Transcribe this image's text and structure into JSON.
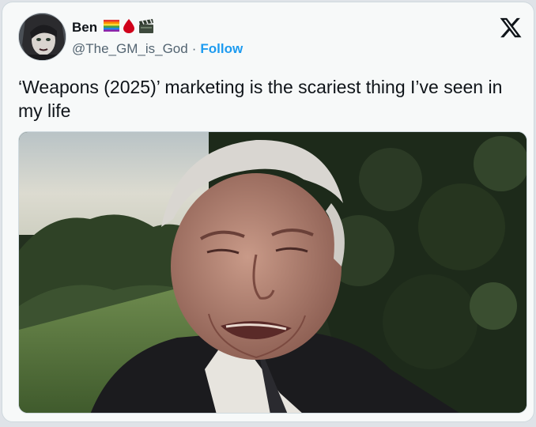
{
  "author": {
    "name": "Ben",
    "badges": [
      "rainbow-flag-emoji",
      "blood-drop-emoji",
      "clapper-board-emoji"
    ],
    "handle": "@The_GM_is_God",
    "separator": "·",
    "follow_label": "Follow"
  },
  "platform_icon": "x-logo-icon",
  "tweet": {
    "text": "‘Weapons (2025)’ marketing is the scariest thing I’ve seen in my life"
  },
  "media": {
    "type": "photo"
  },
  "colors": {
    "accent": "#1d9bf0",
    "text": "#0f1419",
    "muted": "#536471",
    "card_bg": "#f7f9f9"
  }
}
